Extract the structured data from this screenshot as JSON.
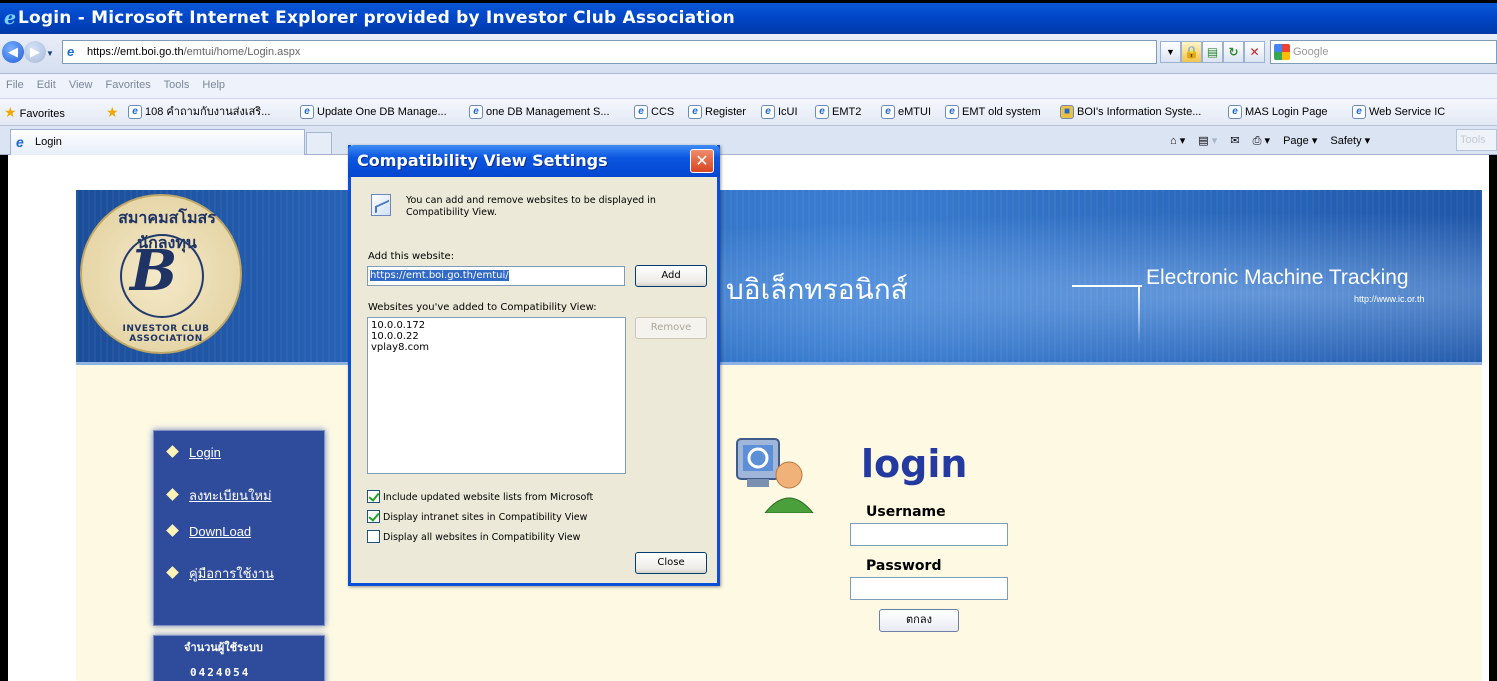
{
  "window": {
    "title": "Login - Microsoft Internet Explorer provided by Investor Club Association"
  },
  "address": {
    "url_host": "https://emt.boi.go.th",
    "url_path": "/emtui/home/Login.aspx",
    "search_placeholder": "Google"
  },
  "menu": [
    "File",
    "Edit",
    "View",
    "Favorites",
    "Tools",
    "Help"
  ],
  "favorites": {
    "label": "Favorites",
    "items": [
      "108 คำถามกับงานส่งเสริ...",
      "Update One DB Manage...",
      "one DB Management S...",
      "CCS",
      "Register",
      "IcUI",
      "EMT2",
      "eMTUI",
      "EMT  old system",
      "BOI's Information Syste...",
      "MAS Login Page",
      "Web Service IC"
    ]
  },
  "tabs": {
    "active_label": "Login"
  },
  "command_bar": {
    "page_label": "Page",
    "safety_label": "Safety",
    "tools_label": "Tools"
  },
  "site": {
    "seal_top_text": "สมาคมสโมสรนักลงทุน",
    "seal_bottom_text": "INVESTOR CLUB ASSOCIATION",
    "banner_thai": "บอิเล็กทรอนิกส์",
    "emt_title": "Electronic Machine Tracking",
    "emt_url": "http://www.ic.or.th",
    "nav": [
      "Login",
      "ลงทะเบียนใหม่",
      "DownLoad",
      "คู่มือการใช้งาน"
    ],
    "counter_label": "จำนวนผู้ใช้ระบบ",
    "counter_value": "0424054",
    "login_heading": "login",
    "username_label": "Username",
    "password_label": "Password",
    "submit_label": "ตกลง"
  },
  "dialog": {
    "title": "Compatibility View Settings",
    "info": "You can add and remove websites to be displayed in Compatibility View.",
    "add_label": "Add this website:",
    "add_value": "https://emt.boi.go.th/emtui/",
    "add_button": "Add",
    "list_label": "Websites you've added to Compatibility View:",
    "sites": [
      "10.0.0.172",
      "10.0.0.22",
      "vplay8.com"
    ],
    "remove_button": "Remove",
    "options": [
      {
        "label": "Include updated website lists from Microsoft",
        "checked": true
      },
      {
        "label": "Display intranet sites in Compatibility View",
        "checked": true
      },
      {
        "label": "Display all websites in Compatibility View",
        "checked": false
      }
    ],
    "close_button": "Close"
  }
}
